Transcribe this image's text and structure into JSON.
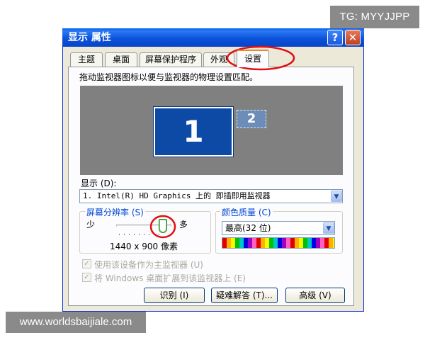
{
  "window": {
    "title": "显示 属性",
    "help_glyph": "?",
    "close_glyph": "✕"
  },
  "tabs": [
    {
      "label": "主题"
    },
    {
      "label": "桌面"
    },
    {
      "label": "屏幕保护程序"
    },
    {
      "label": "外观"
    },
    {
      "label": "设置",
      "active": true
    }
  ],
  "settings": {
    "description": "拖动监视器图标以便与监视器的物理设置匹配。",
    "monitors": [
      {
        "number": "1"
      },
      {
        "number": "2"
      }
    ],
    "display": {
      "label": "显示 (D):",
      "value": "1. Intel(R) HD Graphics 上的 即插即用监视器"
    },
    "resolution": {
      "group_label": "屏幕分辨率 (S)",
      "less": "少",
      "more": "多",
      "value_text": "1440 x 900 像素",
      "slider_level": 0.8
    },
    "color": {
      "group_label": "颜色质量 (C)",
      "value": "最高(32 位)"
    },
    "checkboxes": [
      {
        "label": "使用该设备作为主监视器 (U)",
        "checked": true,
        "enabled": false
      },
      {
        "label": "将 Windows 桌面扩展到该监视器上 (E)",
        "checked": true,
        "enabled": false
      }
    ],
    "buttons": {
      "identify": "识别 (I)",
      "troubleshoot": "疑难解答 (T)...",
      "advanced": "高级 (V)"
    }
  },
  "overlays": {
    "tg": "TG: MYYJJPP",
    "watermark": "www.worldsbaijiale.com"
  },
  "colors": {
    "titlebar": "#0b53da",
    "dialog_bg": "#ece9d8",
    "monitor_area": "#808080",
    "primary_monitor": "#0d4aa6",
    "annotation_red": "#e01010",
    "group_label": "#0046d5"
  }
}
